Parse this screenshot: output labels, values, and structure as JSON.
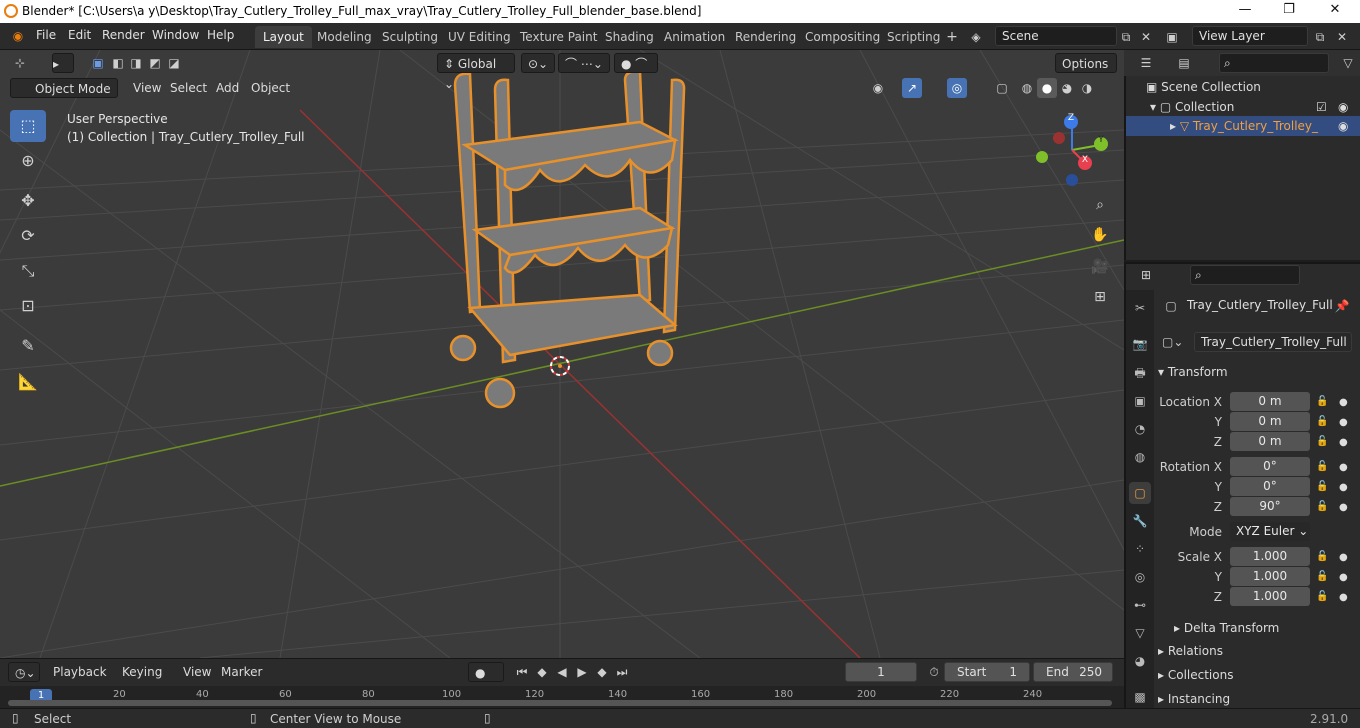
{
  "titlebar": {
    "title": "Blender* [C:\\Users\\a y\\Desktop\\Tray_Cutlery_Trolley_Full_max_vray\\Tray_Cutlery_Trolley_Full_blender_base.blend]",
    "minimize": "—",
    "maximize": "❐",
    "close": "✕"
  },
  "menu": [
    "File",
    "Edit",
    "Render",
    "Window",
    "Help"
  ],
  "workspaces": [
    "Layout",
    "Modeling",
    "Sculpting",
    "UV Editing",
    "Texture Paint",
    "Shading",
    "Animation",
    "Rendering",
    "Compositing",
    "Scripting"
  ],
  "active_workspace": "Layout",
  "scene": {
    "label": "Scene"
  },
  "view_layer": {
    "label": "View Layer"
  },
  "viewport_header": {
    "mode": "Object Mode",
    "menus": [
      "View",
      "Select",
      "Add",
      "Object"
    ],
    "orientation": "Global",
    "options": "Options"
  },
  "viewport": {
    "info_line1": "User Perspective",
    "info_line2": "(1) Collection | Tray_Cutlery_Trolley_Full",
    "gizmo": {
      "x": "X",
      "y": "Y",
      "z": "Z"
    }
  },
  "outliner": {
    "rows": [
      {
        "label": "Scene Collection"
      },
      {
        "label": "Collection"
      },
      {
        "label": "Tray_Cutlery_Trolley_"
      }
    ]
  },
  "properties": {
    "object_name": "Tray_Cutlery_Trolley_Full",
    "data_name": "Tray_Cutlery_Trolley_Full",
    "transform_title": "Transform",
    "location": {
      "label": "Location X",
      "x": "0 m",
      "y": "0 m",
      "z": "0 m"
    },
    "rotation": {
      "label": "Rotation X",
      "x": "0°",
      "y": "0°",
      "z": "90°"
    },
    "mode_label": "Mode",
    "mode_value": "XYZ Euler",
    "scale": {
      "label": "Scale X",
      "x": "1.000",
      "y": "1.000",
      "z": "1.000"
    },
    "axis_y": "Y",
    "axis_z": "Z",
    "delta": "Delta Transform",
    "relations": "Relations",
    "collections": "Collections",
    "instancing": "Instancing"
  },
  "timeline": {
    "menus": [
      "Playback",
      "Keying",
      "View",
      "Marker"
    ],
    "current_frame": "1",
    "start_label": "Start",
    "start": "1",
    "end_label": "End",
    "end": "250",
    "ticks": [
      "1",
      "20",
      "40",
      "60",
      "80",
      "100",
      "120",
      "140",
      "160",
      "180",
      "200",
      "220",
      "240"
    ]
  },
  "statusbar": {
    "left": "Select",
    "middle": "Center View to Mouse",
    "version": "2.91.0"
  }
}
